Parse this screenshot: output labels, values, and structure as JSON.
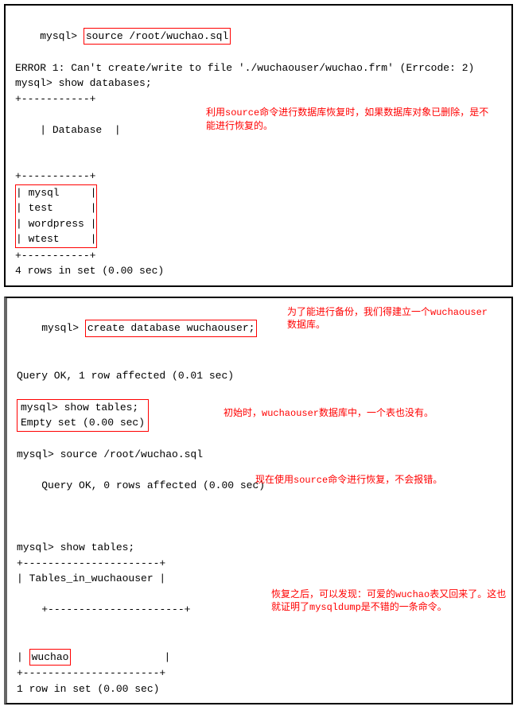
{
  "box1": {
    "prompt1": "mysql> ",
    "cmd1": "source /root/wuchao.sql",
    "error": "ERROR 1: Can't create/write to file './wuchaouser/wuchao.frm' (Errcode: 2)",
    "prompt2": "mysql> show databases;",
    "sep": "+-----------+",
    "header": "| Database  |",
    "row1": "| mysql     |",
    "row2": "| test      |",
    "row3": "| wordpress |",
    "row4": "| wtest     |",
    "result": "4 rows in set (0.00 sec)",
    "annotation1": "利用source命令进行数据库恢复时，如果数据库对象已删除，是不能进行恢复的。"
  },
  "box2": {
    "prompt1": "mysql> ",
    "cmd1": "create database wuchaouser;",
    "result1": "Query OK, 1 row affected (0.01 sec)",
    "annotation1": "为了能进行备份，我们得建立一个wuchaouser数据库。",
    "prompt2": "mysql> show tables;",
    "result2": "Empty set (0.00 sec)",
    "annotation2": "初始时，wuchaouser数据库中，一个表也没有。",
    "prompt3": "mysql> source /root/wuchao.sql",
    "result3": "Query OK, 0 rows affected (0.00 sec)",
    "annotation3": "现在使用source命令进行恢复，不会报错。",
    "prompt4": "mysql> show tables;",
    "sep": "+----------------------+",
    "header": "| Tables_in_wuchaouser |",
    "row1": "| ",
    "row1b": "wuchao",
    "row1c": "               |",
    "result4": "1 row in set (0.00 sec)",
    "annotation4": "恢复之后，可以发现：可爱的wuchao表又回来了。这也就证明了mysqldump是不错的一条命令。"
  }
}
